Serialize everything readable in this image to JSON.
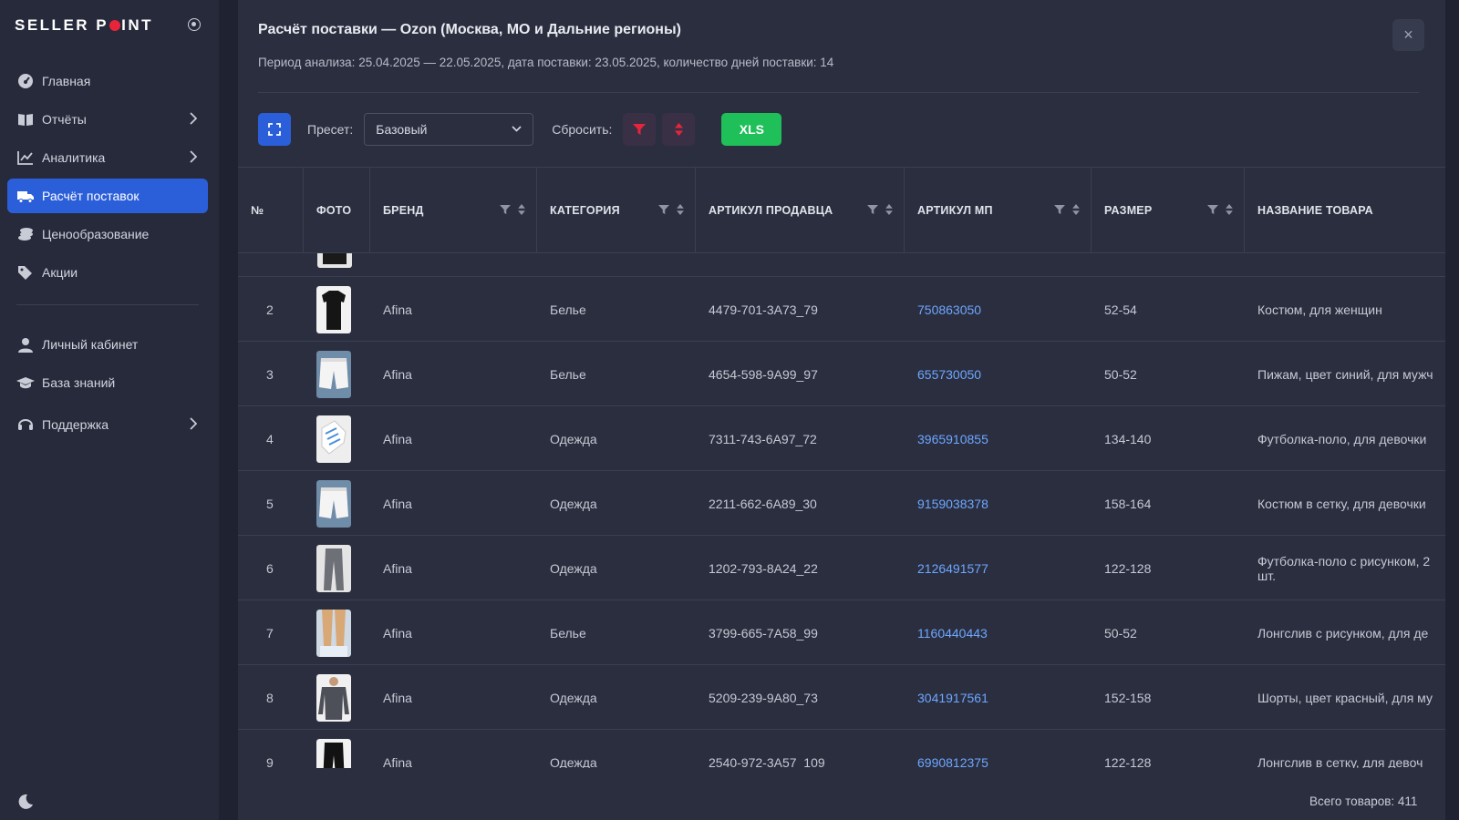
{
  "brand": {
    "left": "SELLER P",
    "right": "INT"
  },
  "sidebar": {
    "items": [
      {
        "label": "Главная",
        "icon": "dashboard-icon",
        "chevron": false,
        "active": false
      },
      {
        "label": "Отчёты",
        "icon": "book-icon",
        "chevron": true,
        "active": false
      },
      {
        "label": "Аналитика",
        "icon": "chart-line-icon",
        "chevron": true,
        "active": false
      },
      {
        "label": "Расчёт поставок",
        "icon": "truck-icon",
        "chevron": false,
        "active": true
      },
      {
        "label": "Ценообразование",
        "icon": "coins-icon",
        "chevron": false,
        "active": false
      },
      {
        "label": "Акции",
        "icon": "tags-icon",
        "chevron": false,
        "active": false
      }
    ],
    "items2": [
      {
        "label": "Личный кабинет",
        "icon": "user-icon",
        "chevron": false
      },
      {
        "label": "База знаний",
        "icon": "graduation-cap-icon",
        "chevron": false
      },
      {
        "label": "Поддержка",
        "icon": "headset-icon",
        "chevron": true
      }
    ]
  },
  "modal": {
    "title": "Расчёт поставки — Ozon (Москва, МО и Дальние регионы)",
    "subtitle": "Период анализа: 25.04.2025 — 22.05.2025, дата поставки: 23.05.2025, количество дней поставки: 14",
    "close": "×"
  },
  "toolbar": {
    "preset_label": "Пресет:",
    "preset_value": "Базовый",
    "reset_label": "Сбросить:",
    "xls_label": "XLS"
  },
  "table": {
    "columns": [
      "№",
      "ФОТО",
      "БРЕНД",
      "КАТЕГОРИЯ",
      "АРТИКУЛ ПРОДАВЦА",
      "АРТИКУЛ МП",
      "РАЗМЕР",
      "НАЗВАНИЕ ТОВАРА"
    ],
    "rows": [
      {
        "n": "2",
        "photo": "black-tshirt",
        "brand": "Afina",
        "category": "Белье",
        "seller_sku": "4479-701-3A73_79",
        "mp_sku": "750863050",
        "size": "52-54",
        "name": "Костюм, для женщин"
      },
      {
        "n": "3",
        "photo": "white-shorts",
        "brand": "Afina",
        "category": "Белье",
        "seller_sku": "4654-598-9A99_97",
        "mp_sku": "655730050",
        "size": "50-52",
        "name": "Пижам, цвет синий, для мужч"
      },
      {
        "n": "4",
        "photo": "white-sneakers",
        "brand": "Afina",
        "category": "Одежда",
        "seller_sku": "7311-743-6A97_72",
        "mp_sku": "3965910855",
        "size": "134-140",
        "name": "Футболка-поло, для девочки"
      },
      {
        "n": "5",
        "photo": "white-shorts",
        "brand": "Afina",
        "category": "Одежда",
        "seller_sku": "2211-662-6A89_30",
        "mp_sku": "9159038378",
        "size": "158-164",
        "name": "Костюм в сетку, для девочки"
      },
      {
        "n": "6",
        "photo": "grey-pants",
        "brand": "Afina",
        "category": "Одежда",
        "seller_sku": "1202-793-8A24_22",
        "mp_sku": "2126491577",
        "size": "122-128",
        "name": "Футболка-поло с рисунком, 2 шт."
      },
      {
        "n": "7",
        "photo": "beige-legs",
        "brand": "Afina",
        "category": "Белье",
        "seller_sku": "3799-665-7A58_99",
        "mp_sku": "1160440443",
        "size": "50-52",
        "name": "Лонгслив с рисунком, для де"
      },
      {
        "n": "8",
        "photo": "grey-longsleeve",
        "brand": "Afina",
        "category": "Одежда",
        "seller_sku": "5209-239-9A80_73",
        "mp_sku": "3041917561",
        "size": "152-158",
        "name": "Шорты, цвет красный, для му"
      },
      {
        "n": "9",
        "photo": "black-pants",
        "brand": "Afina",
        "category": "Одежда",
        "seller_sku": "2540-972-3A57_109",
        "mp_sku": "6990812375",
        "size": "122-128",
        "name": "Лонгслив в сетку, для девоч"
      }
    ]
  },
  "footer": {
    "total": "Всего товаров: 411"
  },
  "colors": {
    "accent": "#2b5fd9",
    "link": "#6ea7ff",
    "xls": "#1fbf5a",
    "danger": "#e8243b"
  }
}
